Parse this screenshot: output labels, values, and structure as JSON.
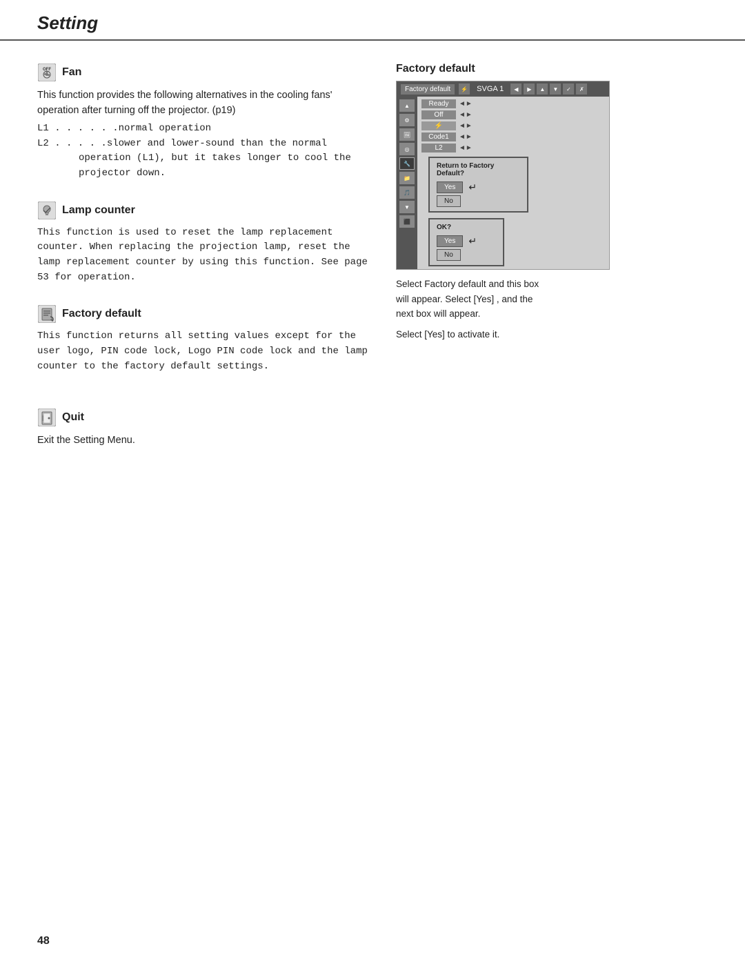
{
  "header": {
    "title": "Setting"
  },
  "sections": {
    "fan": {
      "title": "Fan",
      "body1": "This function provides the following alternatives in the cooling fans' operation after turning off the projector. (p19)",
      "l1": "L1 . . . . . .normal operation",
      "l2_prefix": "L2 . . . . .slower and lower-sound than the normal",
      "l2_indent1": "operation (L1), but it takes longer to cool the",
      "l2_indent2": "projector down."
    },
    "lamp_counter": {
      "title": "Lamp counter",
      "body": "This function is used to reset the lamp replacement counter.  When replacing the projection lamp, reset the lamp replacement counter by using this function.  See page 53 for operation."
    },
    "factory_default_left": {
      "title": "Factory default",
      "body": "This function returns all setting values except for the user logo,  PIN code lock, Logo PIN code lock and the lamp counter to the factory default settings."
    },
    "quit": {
      "title": "Quit",
      "body": "Exit the Setting Menu."
    }
  },
  "right_panel": {
    "title": "Factory default",
    "menu": {
      "top_bar_selected": "Factory default",
      "top_bar_input": "SVGA 1",
      "rows": [
        {
          "label": "Ready",
          "arrow": "◄►"
        },
        {
          "label": "Off",
          "arrow": "◄►"
        },
        {
          "label": "⚡",
          "arrow": "◄►"
        },
        {
          "label": "Code1",
          "arrow": "◄►"
        },
        {
          "label": "L2",
          "arrow": "◄►"
        }
      ]
    },
    "description1": "Select Factory default and this box will appear.  Select [Yes] , and the next box will appear.",
    "popup1": {
      "title": "Return to Factory Default?",
      "yes": "Yes",
      "no": "No"
    },
    "popup2": {
      "title": "OK?",
      "yes": "Yes",
      "no": "No"
    },
    "description2": "Select [Yes] to activate it."
  },
  "footer": {
    "page_number": "48"
  }
}
